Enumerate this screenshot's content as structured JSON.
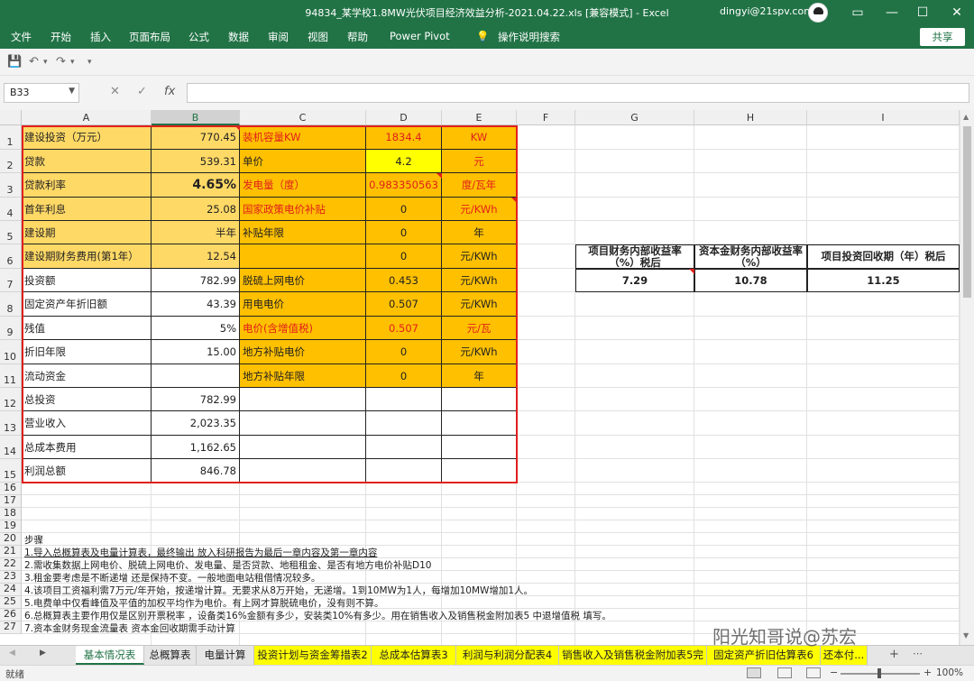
{
  "titlebar": {
    "title": "94834_某学校1.8MW光伏项目经济效益分析-2021.04.22.xls  [兼容模式]  -  Excel",
    "user": "dingyi@21spv.com",
    "minimize": "—",
    "restore": "▭",
    "maximize": "☐",
    "close": "✕"
  },
  "menu": {
    "items": [
      "文件",
      "开始",
      "插入",
      "页面布局",
      "公式",
      "数据",
      "审阅",
      "视图",
      "帮助",
      "Power Pivot"
    ],
    "tell_me": "操作说明搜索",
    "share": "共享"
  },
  "qat": {
    "save": "💾",
    "undo": "↶",
    "undo_drop": "▾",
    "redo": "↷",
    "redo_drop": "▾",
    "custom": "▾"
  },
  "formula_bar": {
    "name_box": "B33",
    "cancel": "✕",
    "enter": "✓",
    "fx": "fx",
    "value": ""
  },
  "columns": [
    "A",
    "B",
    "C",
    "D",
    "E",
    "F",
    "G",
    "H",
    "I"
  ],
  "rows": [
    "1",
    "2",
    "3",
    "4",
    "5",
    "6",
    "7",
    "8",
    "9",
    "10",
    "11",
    "12",
    "13",
    "14",
    "15",
    "16",
    "17",
    "18",
    "19",
    "20",
    "21",
    "22",
    "23",
    "24",
    "25",
    "26",
    "27"
  ],
  "colA": [
    "建设投资（万元）",
    "贷款",
    "贷款利率",
    "首年利息",
    "建设期",
    "建设期财务费用(第1年）",
    "投资额",
    "固定资产年折旧额",
    "残值",
    "折旧年限",
    "流动资金",
    "总投资",
    "营业收入",
    "总成本费用",
    "利润总额"
  ],
  "colB": [
    "770.45",
    "539.31",
    "4.65%",
    "25.08",
    "半年",
    "12.54",
    "782.99",
    "43.39",
    "5%",
    "15.00",
    "",
    "782.99",
    "2,023.35",
    "1,162.65",
    "846.78"
  ],
  "colC": [
    "装机容量KW",
    "单价",
    "发电量（度）",
    "国家政策电价补贴",
    "补贴年限",
    "",
    " 脱硫上网电价",
    "用电电价",
    "电价(含增值税)",
    "地方补贴电价",
    "地方补贴年限",
    "",
    "",
    "",
    ""
  ],
  "colD": [
    "1834.4",
    "4.2",
    "0.983350563",
    "0",
    "0",
    "0",
    "0.453",
    "0.507",
    "0.507",
    "0",
    "0",
    "",
    "",
    "",
    ""
  ],
  "colE": [
    "KW",
    "元",
    "度/瓦年",
    "元/KWh",
    "年",
    "元/KWh",
    "元/KWh",
    "元/KWh",
    "元/瓦",
    "元/KWh",
    "年",
    "",
    "",
    "",
    ""
  ],
  "summary": {
    "headers": [
      "项目财务内部收益率（%）税后",
      "资本金财务内部收益率（%）",
      "项目投资回收期（年）税后"
    ],
    "values": [
      "7.29",
      "10.78",
      "11.25"
    ]
  },
  "notes": [
    "步骤",
    "1.导入总概算表及电量计算表，最终输出 放入科研报告为最后一章内容及第一章内容",
    "2.需收集数据上网电价、脱硫上网电价、发电量、是否贷款、地租租金、是否有地方电价补贴D10",
    "3.租金要考虑是不断递增 还是保持不变。一般地面电站租借情况较多。",
    "4.该项目工资福利需7万元/年开始，按递增计算。无要求从8万开始，无递增。1到10MW为1人，每增加10MW增加1人。",
    "5.电费单中仅看峰值及平值的加权平均作为电价。有上网才算脱硫电价，没有则不算。",
    "6.总概算表主要作用仅是区别开票税率 ，设备类16%金额有多少，安装类10%有多少。用在销售收入及销售税金附加表5 中退增值税 填写。",
    "7.资本金财务现金流量表  资本金回收期需手动计算"
  ],
  "tabs": [
    "基本情况表",
    "总概算表",
    "电量计算",
    "投资计划与资金筹措表2",
    "总成本估算表3",
    "利润与利润分配表4",
    "销售收入及销售税金附加表5完",
    "固定资产折旧估算表6",
    "还本付..."
  ],
  "tab_nav": {
    "prev": "◀",
    "next": "▶",
    "add": "+",
    "more": "⋯"
  },
  "status": {
    "ready": "就绪",
    "zoom": "100%",
    "zoom_out": "−",
    "zoom_in": "+"
  },
  "watermark": "阳光知哥说@苏宏",
  "colors": {
    "accent": "#217346",
    "orange": "#ffc000",
    "light_orange": "#ffd966",
    "yellow": "#ffff00",
    "red": "#e0201b"
  }
}
